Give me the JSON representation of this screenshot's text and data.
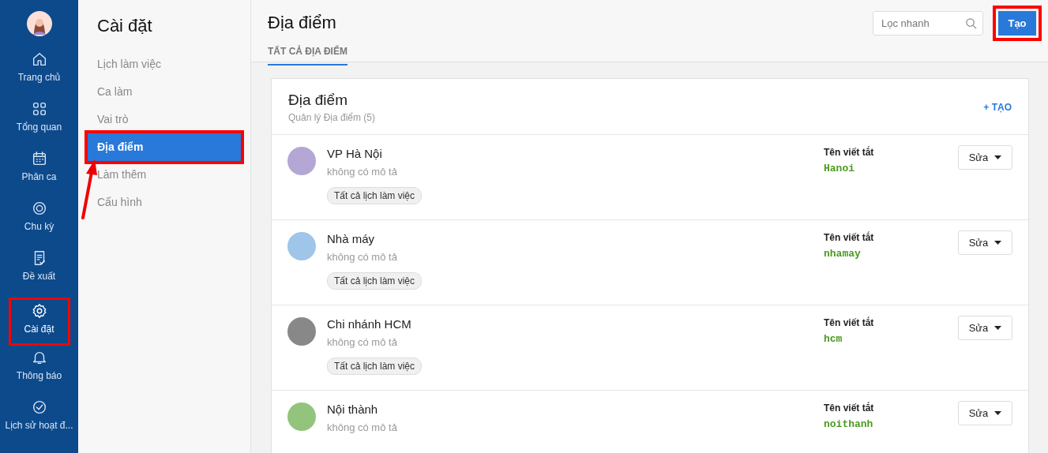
{
  "nav": {
    "items": [
      {
        "label": "Trang chủ",
        "kind": "home",
        "selected": false,
        "highlighted": false
      },
      {
        "label": "Tổng quan",
        "kind": "grid",
        "selected": false,
        "highlighted": false
      },
      {
        "label": "Phân ca",
        "kind": "calendar",
        "selected": false,
        "highlighted": false
      },
      {
        "label": "Chu kỳ",
        "kind": "target",
        "selected": false,
        "highlighted": false
      },
      {
        "label": "Đề xuất",
        "kind": "document",
        "selected": false,
        "highlighted": false
      },
      {
        "label": "Cài đặt",
        "kind": "gear",
        "selected": true,
        "highlighted": true
      },
      {
        "label": "Thông báo",
        "kind": "bell",
        "selected": false,
        "highlighted": false
      },
      {
        "label": "Lịch sử hoạt đ...",
        "kind": "check",
        "selected": false,
        "highlighted": false
      }
    ]
  },
  "settings": {
    "title": "Cài đặt",
    "items": [
      {
        "label": "Lịch làm việc",
        "selected": false,
        "highlighted": false
      },
      {
        "label": "Ca làm",
        "selected": false,
        "highlighted": false
      },
      {
        "label": "Vai trò",
        "selected": false,
        "highlighted": false
      },
      {
        "label": "Địa điểm",
        "selected": true,
        "highlighted": true
      },
      {
        "label": "Làm thêm",
        "selected": false,
        "highlighted": false
      },
      {
        "label": "Cấu hình",
        "selected": false,
        "highlighted": false
      }
    ],
    "annotations": [
      {
        "kind": "arrow"
      }
    ]
  },
  "header": {
    "title": "Địa điểm",
    "tabs": [
      {
        "label": "TẤT CẢ ĐỊA ĐIỂM",
        "selected": true
      }
    ],
    "search": {
      "placeholder": "Lọc nhanh"
    },
    "create_button": {
      "label": "Tạo",
      "highlighted": true
    }
  },
  "card": {
    "title": "Địa điểm",
    "subtitle": "Quản lý Địa điểm (5)",
    "add_link": "+ TẠO",
    "rows": [
      {
        "name": "VP Hà Nội",
        "description": "không có mô tả",
        "tag": "Tất cả lịch làm việc",
        "code_label": "Tên viết tắt",
        "code": "Hanoi",
        "edit": "Sửa",
        "color": "#b4a7d6"
      },
      {
        "name": "Nhà máy",
        "description": "không có mô tả",
        "tag": "Tất cả lịch làm việc",
        "code_label": "Tên viết tắt",
        "code": "nhamay",
        "edit": "Sửa",
        "color": "#9fc5e8"
      },
      {
        "name": "Chi nhánh HCM",
        "description": "không có mô tả",
        "tag": "Tất cả lịch làm việc",
        "code_label": "Tên viết tắt",
        "code": "hcm",
        "edit": "Sửa",
        "color": "#888888"
      },
      {
        "name": "Nội thành",
        "description": "không có mô tả",
        "code_label": "Tên viết tắt",
        "code": "noithanh",
        "edit": "Sửa",
        "color": "#93c47d"
      }
    ]
  }
}
